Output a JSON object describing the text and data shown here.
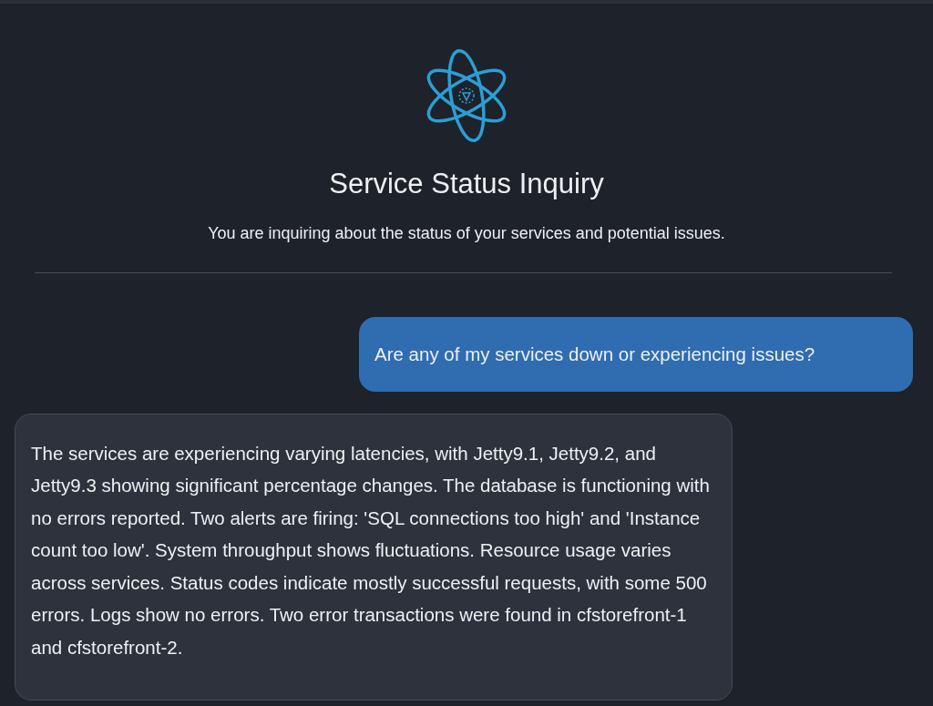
{
  "header": {
    "title": "Service Status Inquiry",
    "subtitle": "You are inquiring about the status of your services and potential issues."
  },
  "messages": [
    {
      "kind": "user",
      "text": "Are any of my services down or experiencing issues?"
    },
    {
      "kind": "assistant",
      "text": "The services are experiencing varying latencies, with Jetty9.1, Jetty9.2, and Jetty9.3 showing significant percentage changes. The database is functioning with no errors reported. Two alerts are firing: 'SQL connections too high' and 'Instance count too low'. System throughput shows fluctuations. Resource usage varies across services. Status codes indicate mostly successful requests, with some 500 errors. Logs show no errors. Two error transactions were found in cfstorefront-1 and cfstorefront-2."
    }
  ]
}
